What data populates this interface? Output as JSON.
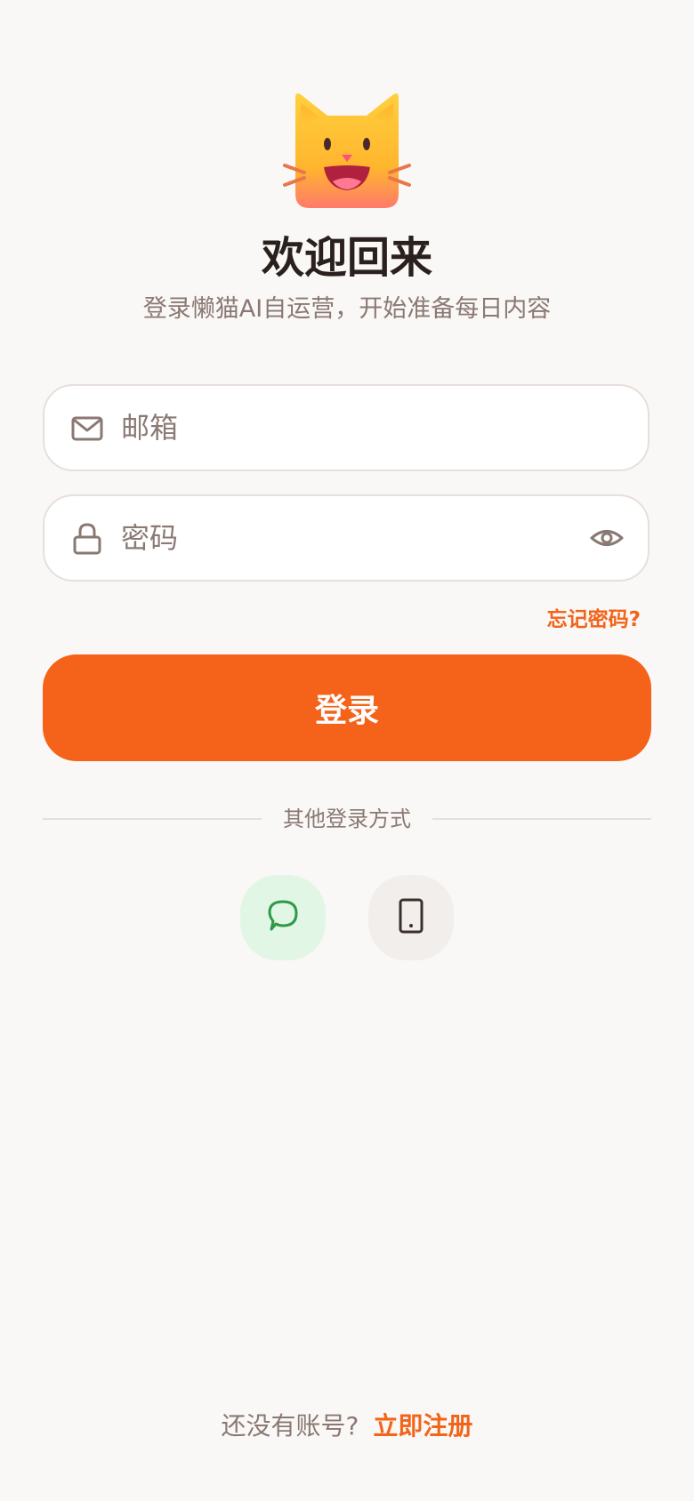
{
  "header": {
    "title": "欢迎回来",
    "subtitle": "登录懒猫AI自运营，开始准备每日内容"
  },
  "form": {
    "email_placeholder": "邮箱",
    "password_placeholder": "密码",
    "forgot_label": "忘记密码?",
    "login_label": "登录"
  },
  "alt_login": {
    "divider_label": "其他登录方式",
    "methods": [
      {
        "icon": "chat-bubble-icon",
        "color": "#2e9a45"
      },
      {
        "icon": "phone-icon",
        "color": "#3b302c"
      }
    ]
  },
  "footer": {
    "prompt": "还没有账号?",
    "register_label": "立即注册"
  },
  "colors": {
    "accent": "#f46319",
    "background": "#faf8f6",
    "text_primary": "#2a211e",
    "text_secondary": "#8a7873"
  }
}
